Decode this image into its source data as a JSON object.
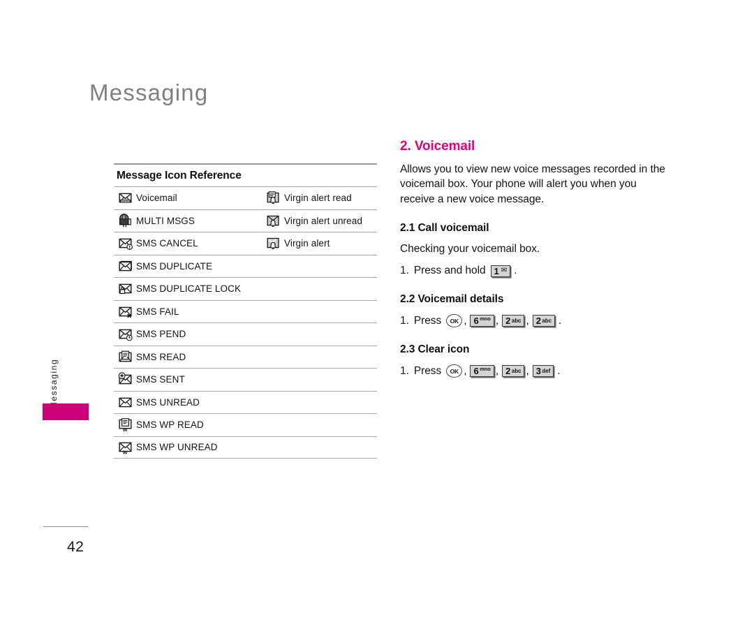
{
  "page": {
    "title": "Messaging",
    "side_tab_label": "Messaging",
    "folio": "42",
    "accent_color": "#e6007e",
    "tab_color": "#cc0077",
    "title_color": "#808080"
  },
  "icon_table": {
    "caption": "Message Icon Reference",
    "left_rows": [
      {
        "icon": "envelope-voicemail-icon",
        "label": "Voicemail"
      },
      {
        "icon": "mailbox-multi-msgs-icon",
        "label": "MULTI MSGS"
      },
      {
        "icon": "envelope-cancel-icon",
        "label": "SMS CANCEL"
      },
      {
        "icon": "envelope-duplicate-icon",
        "label": "SMS DUPLICATE"
      },
      {
        "icon": "envelope-lock-icon",
        "label": "SMS DUPLICATE LOCK"
      },
      {
        "icon": "envelope-fail-icon",
        "label": "SMS FAIL"
      },
      {
        "icon": "envelope-clock-icon",
        "label": "SMS PEND"
      },
      {
        "icon": "envelope-read-icon",
        "label": "SMS READ"
      },
      {
        "icon": "envelope-sent-icon",
        "label": "SMS SENT"
      },
      {
        "icon": "envelope-unread-icon",
        "label": "SMS UNREAD"
      },
      {
        "icon": "envelope-wp-read-icon",
        "label": "SMS WP READ"
      },
      {
        "icon": "envelope-wp-unread-icon",
        "label": "SMS WP UNREAD"
      }
    ],
    "right_rows": [
      {
        "icon": "envelope-bell-read-icon",
        "label": "Virgin alert read"
      },
      {
        "icon": "envelope-bell-unread-icon",
        "label": "Virgin alert unread"
      },
      {
        "icon": "envelope-bell-alert-icon",
        "label": "Virgin alert"
      }
    ]
  },
  "article": {
    "heading": "2. Voicemail",
    "intro": "Allows you to view new voice messages recorded in the voicemail box. Your phone will alert you when you receive a new voice message.",
    "sections": [
      {
        "heading": "2.1 Call voicemail",
        "lead": "Checking your voicemail box.",
        "step_number": "1.",
        "step_verb": "Press and hold",
        "keys": [
          {
            "type": "key",
            "digit": "1",
            "sub": "",
            "envelope": "✉"
          }
        ],
        "period": "."
      },
      {
        "heading": "2.2 Voicemail details",
        "lead": "",
        "step_number": "1.",
        "step_verb": "Press",
        "keys": [
          {
            "type": "ok",
            "label": "OK"
          },
          {
            "type": "key",
            "digit": "6",
            "sup": "mno"
          },
          {
            "type": "key",
            "digit": "2",
            "sub": "abc"
          },
          {
            "type": "key",
            "digit": "2",
            "sub": "abc"
          }
        ],
        "period": "."
      },
      {
        "heading": "2.3 Clear icon",
        "lead": "",
        "step_number": "1.",
        "step_verb": "Press",
        "keys": [
          {
            "type": "ok",
            "label": "OK"
          },
          {
            "type": "key",
            "digit": "6",
            "sup": "mno"
          },
          {
            "type": "key",
            "digit": "2",
            "sub": "abc"
          },
          {
            "type": "key",
            "digit": "3",
            "sub": "def"
          }
        ],
        "period": "."
      }
    ],
    "separator": ","
  }
}
